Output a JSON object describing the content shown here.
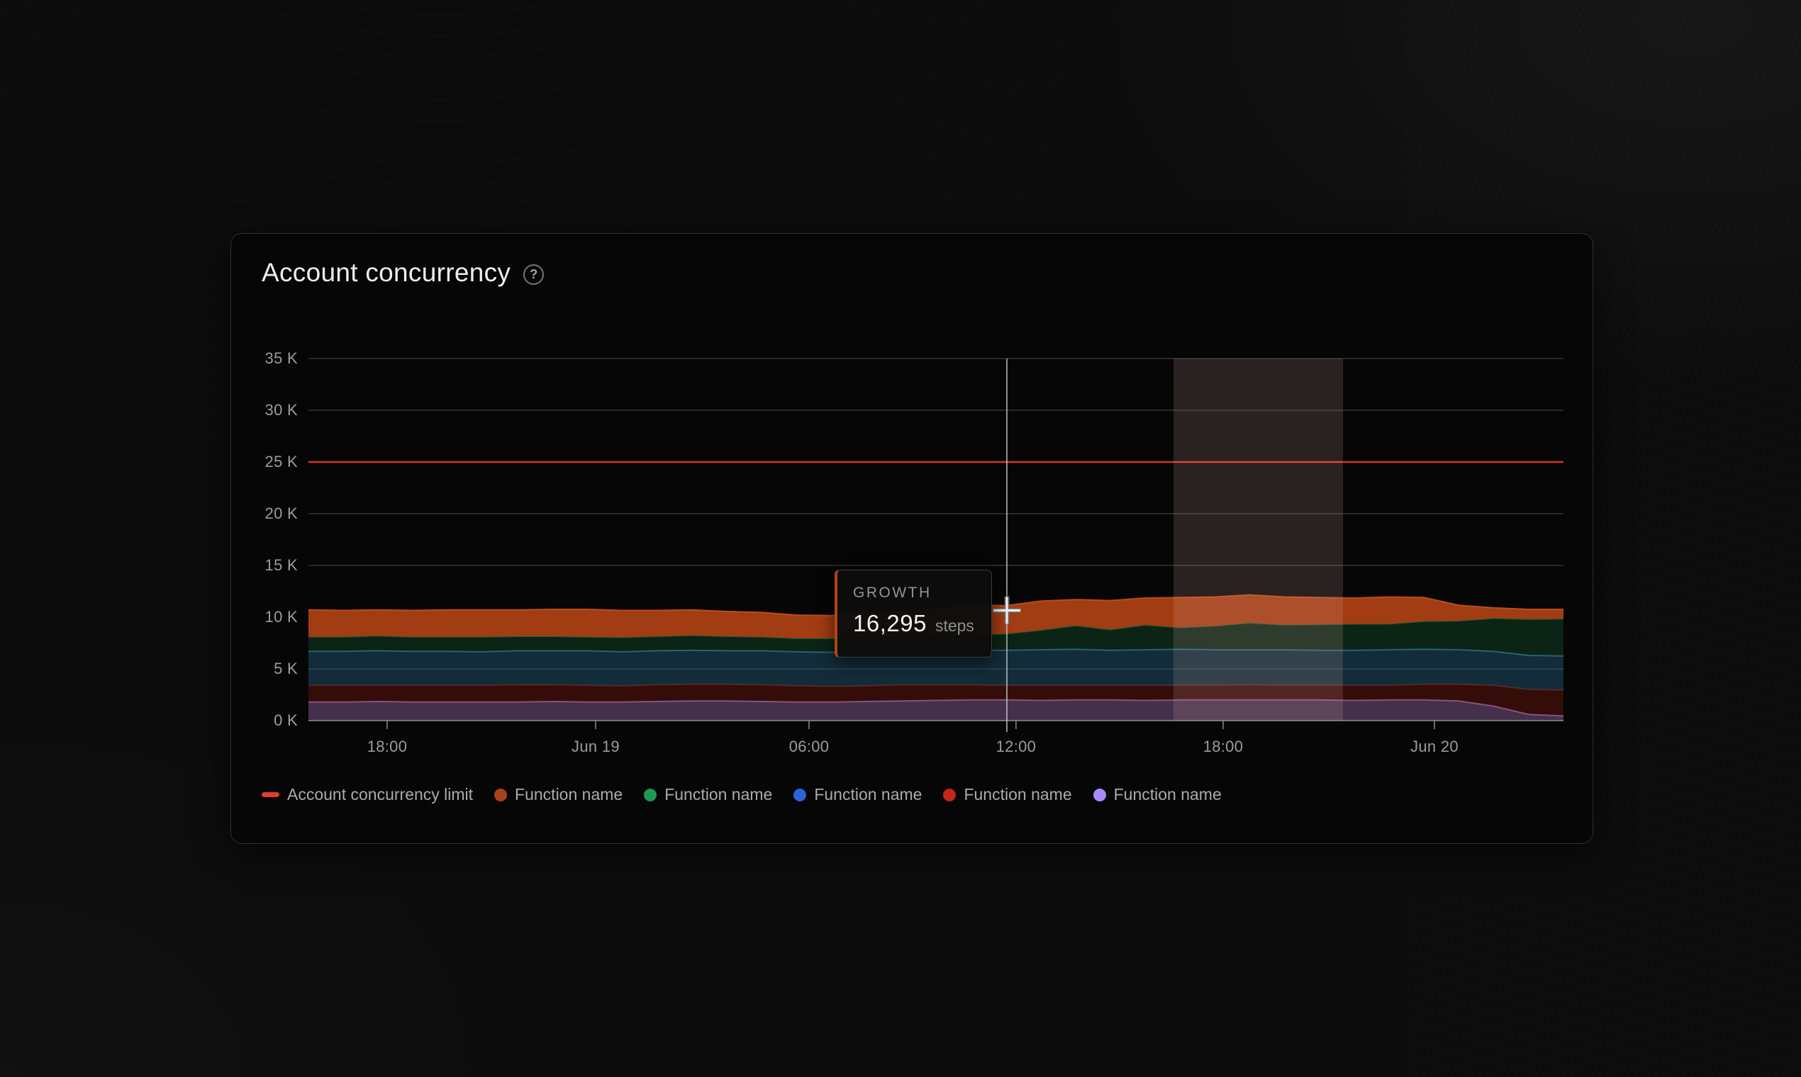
{
  "card": {
    "title": "Account concurrency",
    "help_icon": "?"
  },
  "tooltip": {
    "label": "GROWTH",
    "value": "16,295",
    "unit": "steps"
  },
  "chart_data": {
    "type": "area",
    "stacked": true,
    "title": "Account concurrency",
    "xlabel": "",
    "ylabel": "",
    "unit_scale": "values_k are thousands of steps",
    "ylim": [
      0,
      35000
    ],
    "grid": "horizontal",
    "legend_position": "bottom",
    "y_ticks": [
      {
        "value": 0,
        "label": "0 K"
      },
      {
        "value": 5000,
        "label": "5 K"
      },
      {
        "value": 10000,
        "label": "10 K"
      },
      {
        "value": 15000,
        "label": "15 K"
      },
      {
        "value": 20000,
        "label": "20 K"
      },
      {
        "value": 25000,
        "label": "25 K"
      },
      {
        "value": 30000,
        "label": "30 K"
      },
      {
        "value": 35000,
        "label": "35 K"
      }
    ],
    "x_ticks": [
      {
        "frac": 0.0627,
        "label": "18:00"
      },
      {
        "frac": 0.2288,
        "label": "Jun 19"
      },
      {
        "frac": 0.3989,
        "label": "06:00"
      },
      {
        "frac": 0.5638,
        "label": "12:00"
      },
      {
        "frac": 0.7288,
        "label": "18:00"
      },
      {
        "frac": 0.8972,
        "label": "Jun 20"
      }
    ],
    "limit_line": {
      "label": "Account concurrency limit",
      "value": 25000,
      "color": "#d63526"
    },
    "highlight_region": {
      "from_frac": 0.6893,
      "to_frac": 0.8243,
      "fill": "rgba(229,181,175,0.16)"
    },
    "crosshair": {
      "x_frac": 0.5565,
      "y_value_k": 10.65
    },
    "series": [
      {
        "name": "Function name",
        "legend_color": "#a78bfa",
        "fill": "rgba(163,112,177,0.40)",
        "edge": "#8a5d97",
        "values_k": [
          1.8,
          1.8,
          1.85,
          1.8,
          1.8,
          1.8,
          1.8,
          1.85,
          1.8,
          1.8,
          1.85,
          1.9,
          1.9,
          1.85,
          1.8,
          1.8,
          1.85,
          1.9,
          1.95,
          2.0,
          2.0,
          1.95,
          2.0,
          2.0,
          1.95,
          2.0,
          2.0,
          2.0,
          2.0,
          2.0,
          1.95,
          2.0,
          2.0,
          1.9,
          1.4,
          0.6,
          0.45
        ]
      },
      {
        "name": "Function name",
        "legend_color": "#c1271b",
        "fill": "rgba(160,30,18,0.30)",
        "edge": "#5f1610",
        "values_k": [
          1.6,
          1.6,
          1.55,
          1.6,
          1.6,
          1.6,
          1.65,
          1.6,
          1.6,
          1.55,
          1.6,
          1.6,
          1.6,
          1.6,
          1.55,
          1.5,
          1.5,
          1.55,
          1.5,
          1.45,
          1.4,
          1.45,
          1.4,
          1.4,
          1.45,
          1.4,
          1.4,
          1.45,
          1.4,
          1.4,
          1.45,
          1.4,
          1.5,
          1.6,
          2.0,
          2.4,
          2.5
        ]
      },
      {
        "name": "Function name",
        "legend_color": "#2b63d9",
        "fill": "rgba(48,120,158,0.34)",
        "edge": "#2d6a8d",
        "values_k": [
          3.3,
          3.3,
          3.35,
          3.3,
          3.3,
          3.25,
          3.3,
          3.3,
          3.35,
          3.3,
          3.3,
          3.3,
          3.25,
          3.3,
          3.3,
          3.3,
          3.35,
          3.3,
          3.3,
          3.35,
          3.4,
          3.45,
          3.5,
          3.4,
          3.45,
          3.5,
          3.45,
          3.4,
          3.45,
          3.4,
          3.4,
          3.45,
          3.4,
          3.35,
          3.3,
          3.3,
          3.3
        ]
      },
      {
        "name": "Function name",
        "legend_color": "#1a9a55",
        "fill": "rgba(22,78,42,0.42)",
        "edge": "#17623a",
        "values_k": [
          1.4,
          1.4,
          1.45,
          1.4,
          1.4,
          1.45,
          1.4,
          1.4,
          1.35,
          1.4,
          1.4,
          1.45,
          1.4,
          1.35,
          1.3,
          1.35,
          1.4,
          1.4,
          1.45,
          1.5,
          1.6,
          1.9,
          2.3,
          2.0,
          2.4,
          2.1,
          2.3,
          2.6,
          2.4,
          2.5,
          2.55,
          2.5,
          2.7,
          2.8,
          3.2,
          3.5,
          3.6
        ]
      },
      {
        "name": "Function name",
        "legend_color": "#a8431a",
        "fill": "#a23c12",
        "edge": "#c14e1b",
        "values_k": [
          2.6,
          2.55,
          2.5,
          2.55,
          2.6,
          2.6,
          2.55,
          2.6,
          2.65,
          2.6,
          2.5,
          2.45,
          2.4,
          2.35,
          2.25,
          2.2,
          2.3,
          2.4,
          2.5,
          2.9,
          2.7,
          2.8,
          2.5,
          2.8,
          2.6,
          2.9,
          2.8,
          2.7,
          2.7,
          2.6,
          2.5,
          2.6,
          2.3,
          1.5,
          1.0,
          0.95,
          0.9
        ]
      }
    ],
    "legend": [
      {
        "label": "Account concurrency limit",
        "color": "#e23b2c",
        "marker": "dash"
      },
      {
        "label": "Function name",
        "color": "#a8431a",
        "marker": "dot"
      },
      {
        "label": "Function name",
        "color": "#1a9a55",
        "marker": "dot"
      },
      {
        "label": "Function name",
        "color": "#2b63d9",
        "marker": "dot"
      },
      {
        "label": "Function name",
        "color": "#c1271b",
        "marker": "dot"
      },
      {
        "label": "Function name",
        "color": "#a78bfa",
        "marker": "dot"
      }
    ]
  }
}
